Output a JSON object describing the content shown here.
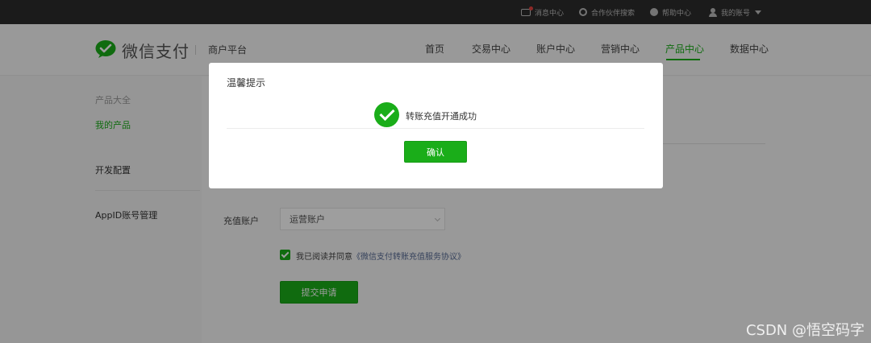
{
  "topbar": {
    "message_center": "消息中心",
    "partner_search": "合作伙伴搜索",
    "help_center": "帮助中心",
    "my_account": "我的账号"
  },
  "header": {
    "logo_text": "微信支付",
    "platform": "商户平台",
    "nav": [
      "首页",
      "交易中心",
      "账户中心",
      "营销中心",
      "产品中心",
      "数据中心"
    ],
    "active_nav": "产品中心"
  },
  "sidebar": {
    "items": [
      "产品大全",
      "我的产品",
      "开发配置",
      "AppID账号管理"
    ]
  },
  "form": {
    "account_label": "充值账户",
    "account_value": "运营账户",
    "agree_prefix": "我已阅读并同意",
    "agree_link": "《微信支付转账充值服务协议》",
    "submit_label": "提交申请"
  },
  "modal": {
    "title": "温馨提示",
    "message": "转账充值开通成功",
    "ok_label": "确认"
  },
  "watermark": "CSDN @悟空码字",
  "colors": {
    "brand_green": "#1aad19",
    "topbar": "#2c2c2c",
    "link": "#576b95"
  }
}
